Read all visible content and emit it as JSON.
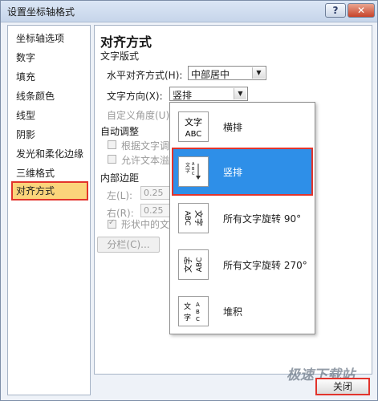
{
  "window": {
    "title": "设置坐标轴格式",
    "help": "?",
    "close": "✕"
  },
  "nav": {
    "items": [
      {
        "label": "坐标轴选项"
      },
      {
        "label": "数字"
      },
      {
        "label": "填充"
      },
      {
        "label": "线条颜色"
      },
      {
        "label": "线型"
      },
      {
        "label": "阴影"
      },
      {
        "label": "发光和柔化边缘"
      },
      {
        "label": "三维格式"
      },
      {
        "label": "对齐方式"
      }
    ],
    "selected": "对齐方式"
  },
  "panel": {
    "title": "对齐方式",
    "text_layout": "文字版式",
    "h_align_label": "水平对齐方式(H):",
    "h_align_value": "中部居中",
    "text_dir_label": "文字方向(X):",
    "text_dir_value": "竖排",
    "custom_angle_label": "自定义角度(U):",
    "autofit": "自动调整",
    "autofit_resize": "根据文字调",
    "autofit_overflow": "允许文本溢",
    "inner_margin": "内部边距",
    "left_label": "左(L):",
    "left_value": "0.25",
    "right_label": "右(R):",
    "right_value": "0.25",
    "wrap_label": "形状中的文",
    "columns_button": "分栏(C)..."
  },
  "dropdown": {
    "options": [
      {
        "label": "横排",
        "icon": "horizontal-text-icon"
      },
      {
        "label": "竖排",
        "icon": "stacked-vertical-icon"
      },
      {
        "label": "所有文字旋转 90°",
        "icon": "rotate-90-icon"
      },
      {
        "label": "所有文字旋转 270°",
        "icon": "rotate-270-icon"
      },
      {
        "label": "堆积",
        "icon": "stacked-text-icon"
      }
    ],
    "selected": "竖排"
  },
  "footer": {
    "close_button": "关闭",
    "watermark": "极速下载站"
  },
  "colors": {
    "highlight": "#2e8fe8",
    "nav_selected": "#fbd47b",
    "callout": "#e2342c"
  }
}
